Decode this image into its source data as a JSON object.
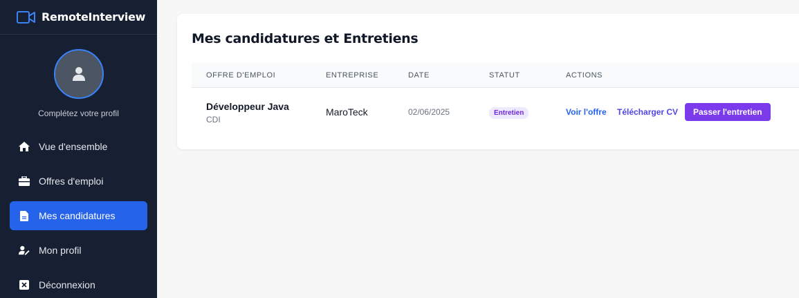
{
  "app": {
    "brand_name": "RemoteInterview",
    "brand_icon": "video-camera-icon",
    "accent_color": "#2563eb"
  },
  "sidebar": {
    "profile_text": "Complétez votre profil",
    "items": [
      {
        "label": "Vue d'ensemble",
        "icon": "home-icon",
        "active": false
      },
      {
        "label": "Offres d'emploi",
        "icon": "briefcase-icon",
        "active": false
      },
      {
        "label": "Mes candidatures",
        "icon": "document-icon",
        "active": true
      },
      {
        "label": "Mon profil",
        "icon": "user-edit-icon",
        "active": false
      },
      {
        "label": "Déconnexion",
        "icon": "close-box-icon",
        "active": false
      }
    ]
  },
  "main": {
    "title": "Mes candidatures et Entretiens",
    "table": {
      "headers": [
        "OFFRE D'EMPLOI",
        "ENTREPRISE",
        "DATE",
        "STATUT",
        "ACTIONS"
      ],
      "rows": [
        {
          "job_title": "Développeur Java",
          "job_type": "CDI",
          "company": "MaroTeck",
          "date": "02/06/2025",
          "status": "Entretien",
          "actions": {
            "view_offer": "Voir l'offre",
            "download_cv": "Télécharger CV",
            "start_interview": "Passer l'entretien"
          }
        }
      ]
    }
  }
}
